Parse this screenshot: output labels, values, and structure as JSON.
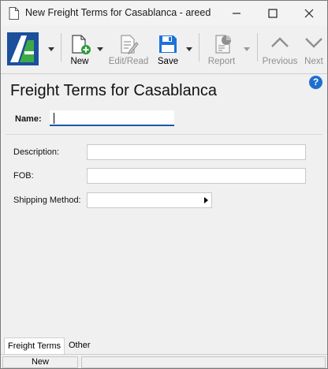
{
  "window": {
    "title": "New Freight Terms for Casablanca - areed"
  },
  "toolbar": {
    "new_label": "New",
    "edit_read_label": "Edit/Read",
    "save_label": "Save",
    "report_label": "Report",
    "previous_label": "Previous",
    "next_label": "Next"
  },
  "form": {
    "title": "Freight Terms for Casablanca",
    "name_label": "Name:",
    "name_value": "",
    "description_label": "Description:",
    "description_value": "",
    "fob_label": "FOB:",
    "fob_value": "",
    "shipping_method_label": "Shipping Method:",
    "shipping_method_value": ""
  },
  "tabs": [
    {
      "label": "Freight Terms",
      "active": true
    },
    {
      "label": "Other",
      "active": false
    }
  ],
  "status": {
    "mode": "New"
  },
  "colors": {
    "accent": "#1c58a6",
    "save_icon": "#1e73d6",
    "new_plus": "#2e9b3a",
    "help": "#1e6fd0"
  }
}
